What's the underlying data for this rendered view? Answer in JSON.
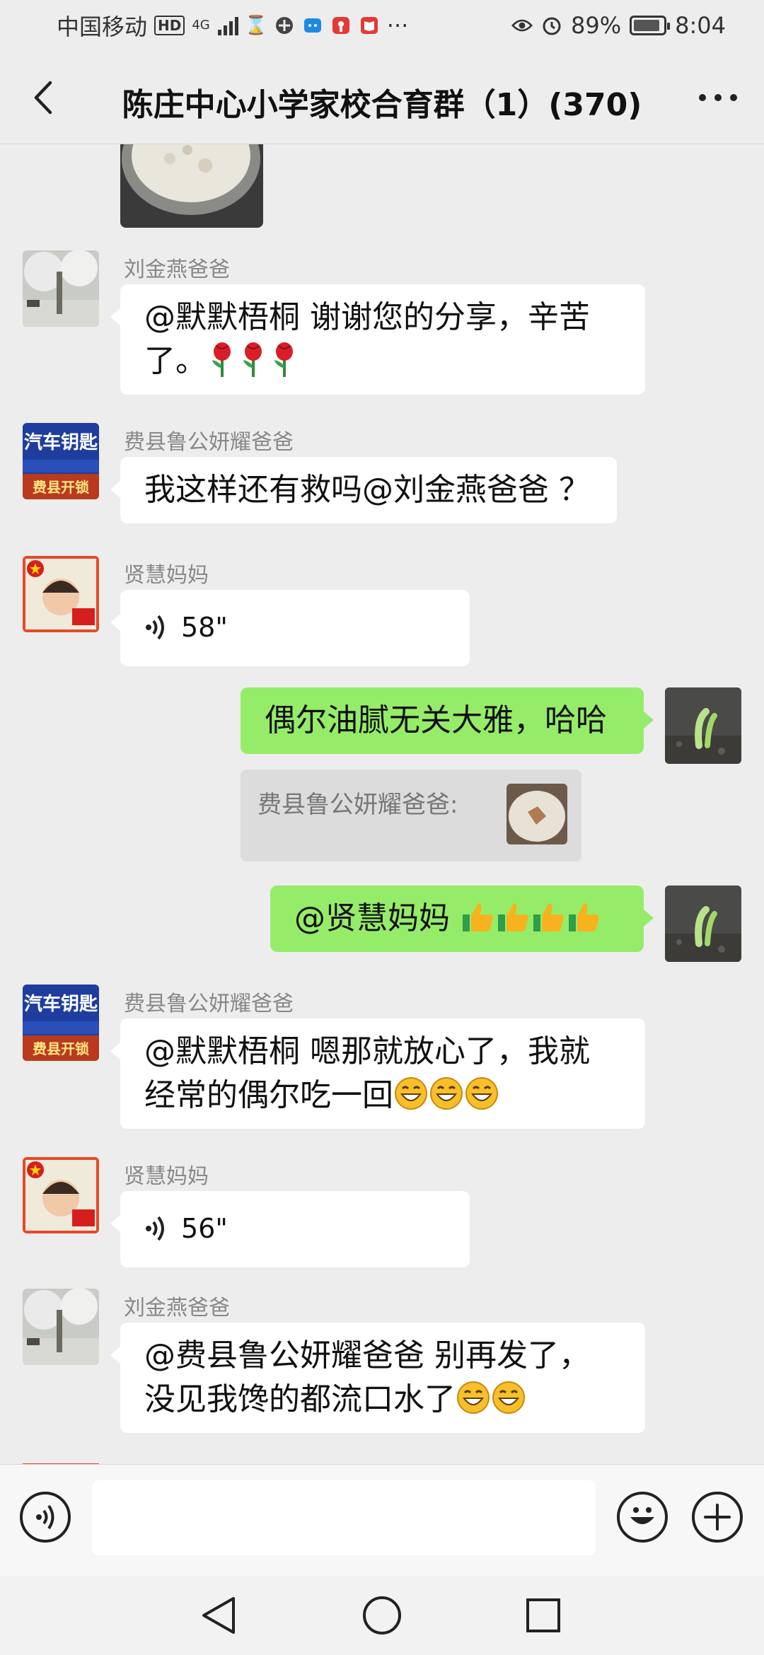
{
  "status_bar": {
    "carrier": "中国移动",
    "hd": "HD",
    "network": "4G",
    "battery": "89%",
    "battery_level": 0.89,
    "time": "8:04",
    "more": "···"
  },
  "header": {
    "title": "陈庄中心小学家校合育群（1）(370)"
  },
  "messages": [
    {
      "sender": "刘金燕爸爸",
      "text": "@默默梧桐  谢谢您的分享，辛苦了。"
    },
    {
      "sender": "费县鲁公妍耀爸爸",
      "text": "我这样还有救吗@刘金燕爸爸 ？"
    },
    {
      "sender": "贤慧妈妈",
      "duration": "58\""
    },
    {
      "sender": "",
      "text": "偶尔油腻无关大雅，哈哈"
    },
    {
      "sender": "",
      "quote": "费县鲁公妍耀爸爸:"
    },
    {
      "sender": "",
      "text": "@贤慧妈妈 "
    },
    {
      "sender": "费县鲁公妍耀爸爸",
      "text_line1": "@默默梧桐  嗯那就放心了，我就",
      "text_line2": "经常的偶尔吃一回"
    },
    {
      "sender": "贤慧妈妈",
      "duration": "56\""
    },
    {
      "sender": "刘金燕爸爸",
      "text_line1": "@费县鲁公妍耀爸爸  别再发了，",
      "text_line2": "没见我馋的都流口水了"
    }
  ],
  "avatar_text": {
    "car_key_line1": "汽车钥匙",
    "car_key_line2": "费县开锁"
  },
  "icons": {
    "back": "chevron-left-icon",
    "more": "more-horizontal-icon",
    "voice": "voice-icon",
    "emoji": "emoji-face-icon",
    "plus": "plus-icon"
  },
  "colors": {
    "background": "#ededed",
    "my_bubble": "#95ec69",
    "other_bubble": "#ffffff"
  }
}
